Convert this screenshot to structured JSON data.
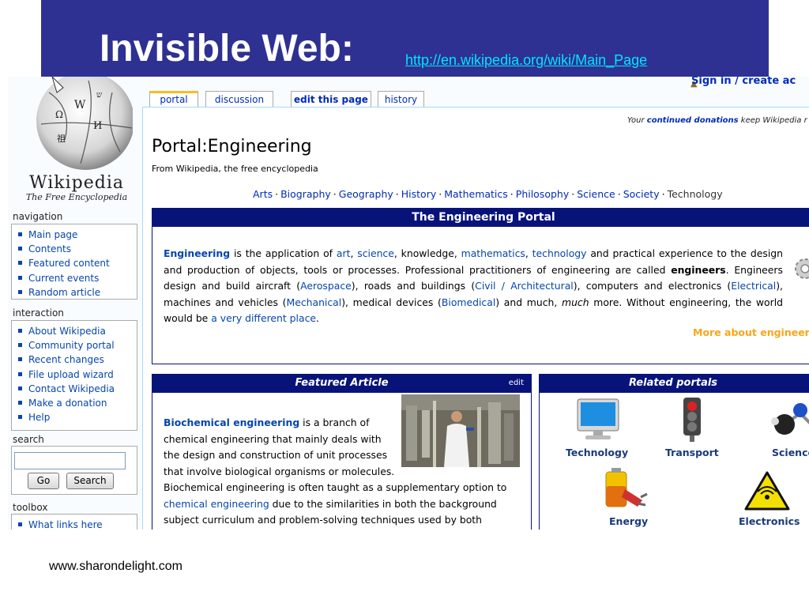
{
  "slide": {
    "title": "Invisible Web:",
    "link": "http://en.wikipedia.org/wiki/Main_Page",
    "footer": "www.sharondelight.com",
    "band_color": "#2e3192"
  },
  "wiki": {
    "logo": {
      "wordmark": "Wikipedia",
      "tagline": "The Free Encyclopedia"
    },
    "signin": "Sign in / create ac",
    "tabs": [
      "portal",
      "discussion",
      "edit this page",
      "history"
    ],
    "donation": {
      "prefix": "Your ",
      "link": "continued donations",
      "suffix": " keep Wikipedia r"
    },
    "navigation": {
      "title": "navigation",
      "items": [
        "Main page",
        "Contents",
        "Featured content",
        "Current events",
        "Random article"
      ]
    },
    "interaction": {
      "title": "interaction",
      "items": [
        "About Wikipedia",
        "Community portal",
        "Recent changes",
        "File upload wizard",
        "Contact Wikipedia",
        "Make a donation",
        "Help"
      ]
    },
    "search": {
      "title": "search",
      "go": "Go",
      "search": "Search",
      "value": ""
    },
    "toolbox": {
      "title": "toolbox",
      "items": [
        "What links here"
      ]
    },
    "page_title": "Portal:Engineering",
    "tagline": "From Wikipedia, the free encyclopedia",
    "topics": [
      "Arts",
      "Biography",
      "Geography",
      "History",
      "Mathematics",
      "Philosophy",
      "Science",
      "Society",
      "Technology"
    ],
    "topic_separator": "·",
    "portal_header": "The Engineering Portal",
    "intro": {
      "t1": "Engineering",
      "t2": " is the application of ",
      "t3": "art",
      "t4": ", ",
      "t5": "science",
      "t6": ", knowledge, ",
      "t7": "mathematics",
      "t8": ", ",
      "t9": "technology",
      "t10": " and practical experience to the design and production of objects, tools or processes. Professional practitioners of engineering are called ",
      "t11": "engineers",
      "t12": ". Engineers design and build aircraft (",
      "t13": "Aerospace",
      "t14": "), roads and buildings (",
      "t15": "Civil / Architectural",
      "t16": "), computers and electronics (",
      "t17": "Electrical",
      "t18": "), machines and vehicles (",
      "t19": "Mechanical",
      "t20": "), medical devices (",
      "t21": "Biomedical",
      "t22": ") and much, ",
      "t23": "much",
      "t24": " more. Without engineering, the world would be ",
      "t25": "a very different place",
      "t26": "."
    },
    "more_link": "More about engineer",
    "featured": {
      "header": "Featured Article",
      "edit": "edit",
      "t1": "Biochemical engineering",
      "t2": " is a branch of chemical engineering that mainly deals with the design and construction of unit processes that involve biological organisms or molecules.",
      "t3": "Biochemical engineering is often taught as a supplementary option to ",
      "t4": "chemical engineering",
      "t5": " due to the similarities in both the background subject curriculum and problem-solving techniques used by both"
    },
    "related": {
      "header": "Related portals",
      "portals": [
        "Technology",
        "Transport",
        "Science",
        "Energy",
        "Electronics"
      ]
    }
  }
}
